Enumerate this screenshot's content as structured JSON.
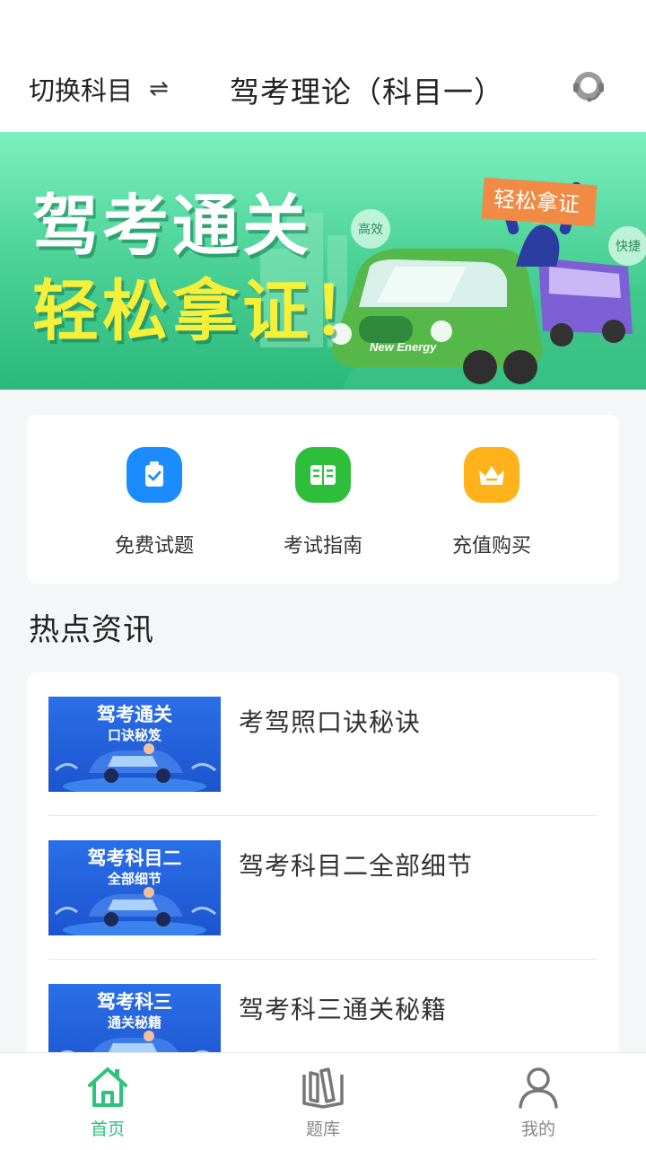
{
  "header": {
    "switch_label": "切换科目",
    "switch_icon": "⇌",
    "title": "驾考理论（科目一）"
  },
  "banner": {
    "line1": "驾考通关",
    "line2": "轻松拿证！",
    "sign": "轻松拿证",
    "bubble1": "高效",
    "bubble2": "快捷",
    "car_text": "New Energy"
  },
  "quick_actions": [
    {
      "label": "免费试题",
      "icon": "clipboard-check-icon",
      "color": "#1a8cff"
    },
    {
      "label": "考试指南",
      "icon": "book-icon",
      "color": "#2dbe3a"
    },
    {
      "label": "充值购买",
      "icon": "crown-icon",
      "color": "#ffb21a"
    }
  ],
  "hot_news": {
    "title": "热点资讯",
    "items": [
      {
        "title": "考驾照口诀秘诀",
        "thumb_line1": "驾考通关",
        "thumb_line2": "口诀秘笈"
      },
      {
        "title": "驾考科目二全部细节",
        "thumb_line1": "驾考科目二",
        "thumb_line2": "全部细节"
      },
      {
        "title": "驾考科三通关秘籍",
        "thumb_line1": "驾考科三",
        "thumb_line2": "通关秘籍"
      }
    ]
  },
  "tabbar": {
    "items": [
      {
        "label": "首页",
        "active": true
      },
      {
        "label": "题库",
        "active": false
      },
      {
        "label": "我的",
        "active": false
      }
    ],
    "active_color": "#2ec27e"
  }
}
